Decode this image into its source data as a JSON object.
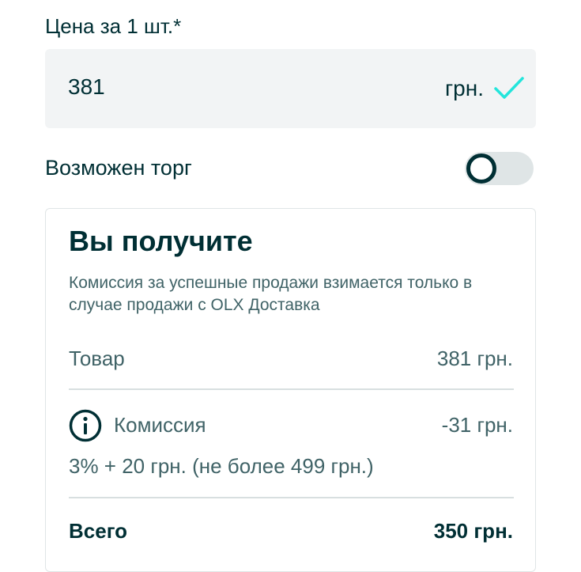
{
  "price": {
    "label": "Цена за 1 шт.*",
    "value": "381",
    "currency": "грн.",
    "check_color": "#23e5db"
  },
  "bargain": {
    "label": "Возможен торг",
    "enabled": false
  },
  "summary": {
    "title": "Вы получите",
    "description": "Комиссия за успешные продажи взимается только в случае продажи с OLX Доставка",
    "item_label": "Товар",
    "item_value": "381 грн.",
    "commission_label": "Комиссия",
    "commission_value": "-31 грн.",
    "commission_formula": "3% + 20 грн. (не более 499 грн.)",
    "total_label": "Всего",
    "total_value": "350 грн."
  }
}
